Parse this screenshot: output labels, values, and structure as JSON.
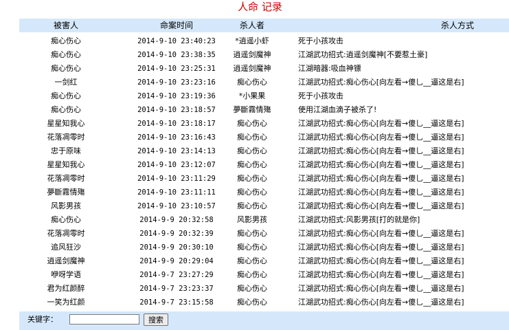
{
  "title": "人命 记录",
  "headers": {
    "victim": "被害人",
    "time": "命案时间",
    "killer": "杀人者",
    "method": "杀人方式"
  },
  "rows": [
    {
      "victim": "痴心伤心",
      "time": "2014-9-10 23:40:23",
      "killer": "*逍遥小虾",
      "method": "死于小孩攻击"
    },
    {
      "victim": "痴心伤心",
      "time": "2014-9-10 23:38:35",
      "killer": "逍遥剑魔神",
      "method": "江湖武功招式:逍遥剑魔神[不要惹土豪]"
    },
    {
      "victim": "痴心伤心",
      "time": "2014-9-10 23:25:31",
      "killer": "逍遥剑魔神",
      "method": "江湖暗器:吸血神镖"
    },
    {
      "victim": "一剑红",
      "time": "2014-9-10 23:23:16",
      "killer": "痴心伤心",
      "method": "江湖武功招式:痴心伤心[向左看→傻乚__逼这是右]"
    },
    {
      "victim": "痴心伤心",
      "time": "2014-9-10 23:19:36",
      "killer": "*小果果",
      "method": "死于小孩攻击"
    },
    {
      "victim": "痴心伤心",
      "time": "2014-9-10 23:18:57",
      "killer": "夢斷霧情殤",
      "method": "使用江湖血滴子被杀了!"
    },
    {
      "victim": "星星知我心",
      "time": "2014-9-10 23:18:17",
      "killer": "痴心伤心",
      "method": "江湖武功招式:痴心伤心[向左看→傻乚__逼这是右]"
    },
    {
      "victim": "花落凋零时",
      "time": "2014-9-10 23:16:43",
      "killer": "痴心伤心",
      "method": "江湖武功招式:痴心伤心[向左看→傻乚__逼这是右]"
    },
    {
      "victim": "忠于原味",
      "time": "2014-9-10 23:14:13",
      "killer": "痴心伤心",
      "method": "江湖武功招式:痴心伤心[向左看→傻乚__逼这是右]"
    },
    {
      "victim": "星星知我心",
      "time": "2014-9-10 23:12:07",
      "killer": "痴心伤心",
      "method": "江湖武功招式:痴心伤心[向左看→傻乚__逼这是右]"
    },
    {
      "victim": "花落凋零时",
      "time": "2014-9-10 23:11:29",
      "killer": "痴心伤心",
      "method": "江湖武功招式:痴心伤心[向左看→傻乚__逼这是右]"
    },
    {
      "victim": "夢斷霧情殤",
      "time": "2014-9-10 23:11:11",
      "killer": "痴心伤心",
      "method": "江湖武功招式:痴心伤心[向左看→傻乚__逼这是右]"
    },
    {
      "victim": "风影男孩",
      "time": "2014-9-10 23:10:57",
      "killer": "痴心伤心",
      "method": "江湖武功招式:痴心伤心[向左看→傻乚__逼这是右]"
    },
    {
      "victim": "痴心伤心",
      "time": "2014-9-9 20:32:58",
      "killer": "风影男孩",
      "method": "江湖武功招式:风影男孩[打的就是你]"
    },
    {
      "victim": "花落凋零时",
      "time": "2014-9-9 20:32:39",
      "killer": "痴心伤心",
      "method": "江湖武功招式:痴心伤心[向左看→傻乚__逼这是右]"
    },
    {
      "victim": "追风狂沙",
      "time": "2014-9-9 20:30:10",
      "killer": "痴心伤心",
      "method": "江湖武功招式:痴心伤心[向左看→傻乚__逼这是右]"
    },
    {
      "victim": "逍遥剑魔神",
      "time": "2014-9-9 20:29:04",
      "killer": "痴心伤心",
      "method": "江湖武功招式:痴心伤心[向左看→傻乚__逼这是右]"
    },
    {
      "victim": "咿呀学语",
      "time": "2014-9-7 23:27:29",
      "killer": "痴心伤心",
      "method": "江湖武功招式:痴心伤心[向左看→傻乚__逼这是右]"
    },
    {
      "victim": "君为红颜醉",
      "time": "2014-9-7 23:23:37",
      "killer": "痴心伤心",
      "method": "江湖武功招式:痴心伤心[向左看→傻乚__逼这是右]"
    },
    {
      "victim": "一笑为红颜",
      "time": "2014-9-7 23:15:58",
      "killer": "痴心伤心",
      "method": "江湖武功招式:痴心伤心[向左看→傻乚__逼这是右]"
    }
  ],
  "search": {
    "label": "关键字：",
    "value": "",
    "placeholder": "",
    "button": "搜索"
  }
}
